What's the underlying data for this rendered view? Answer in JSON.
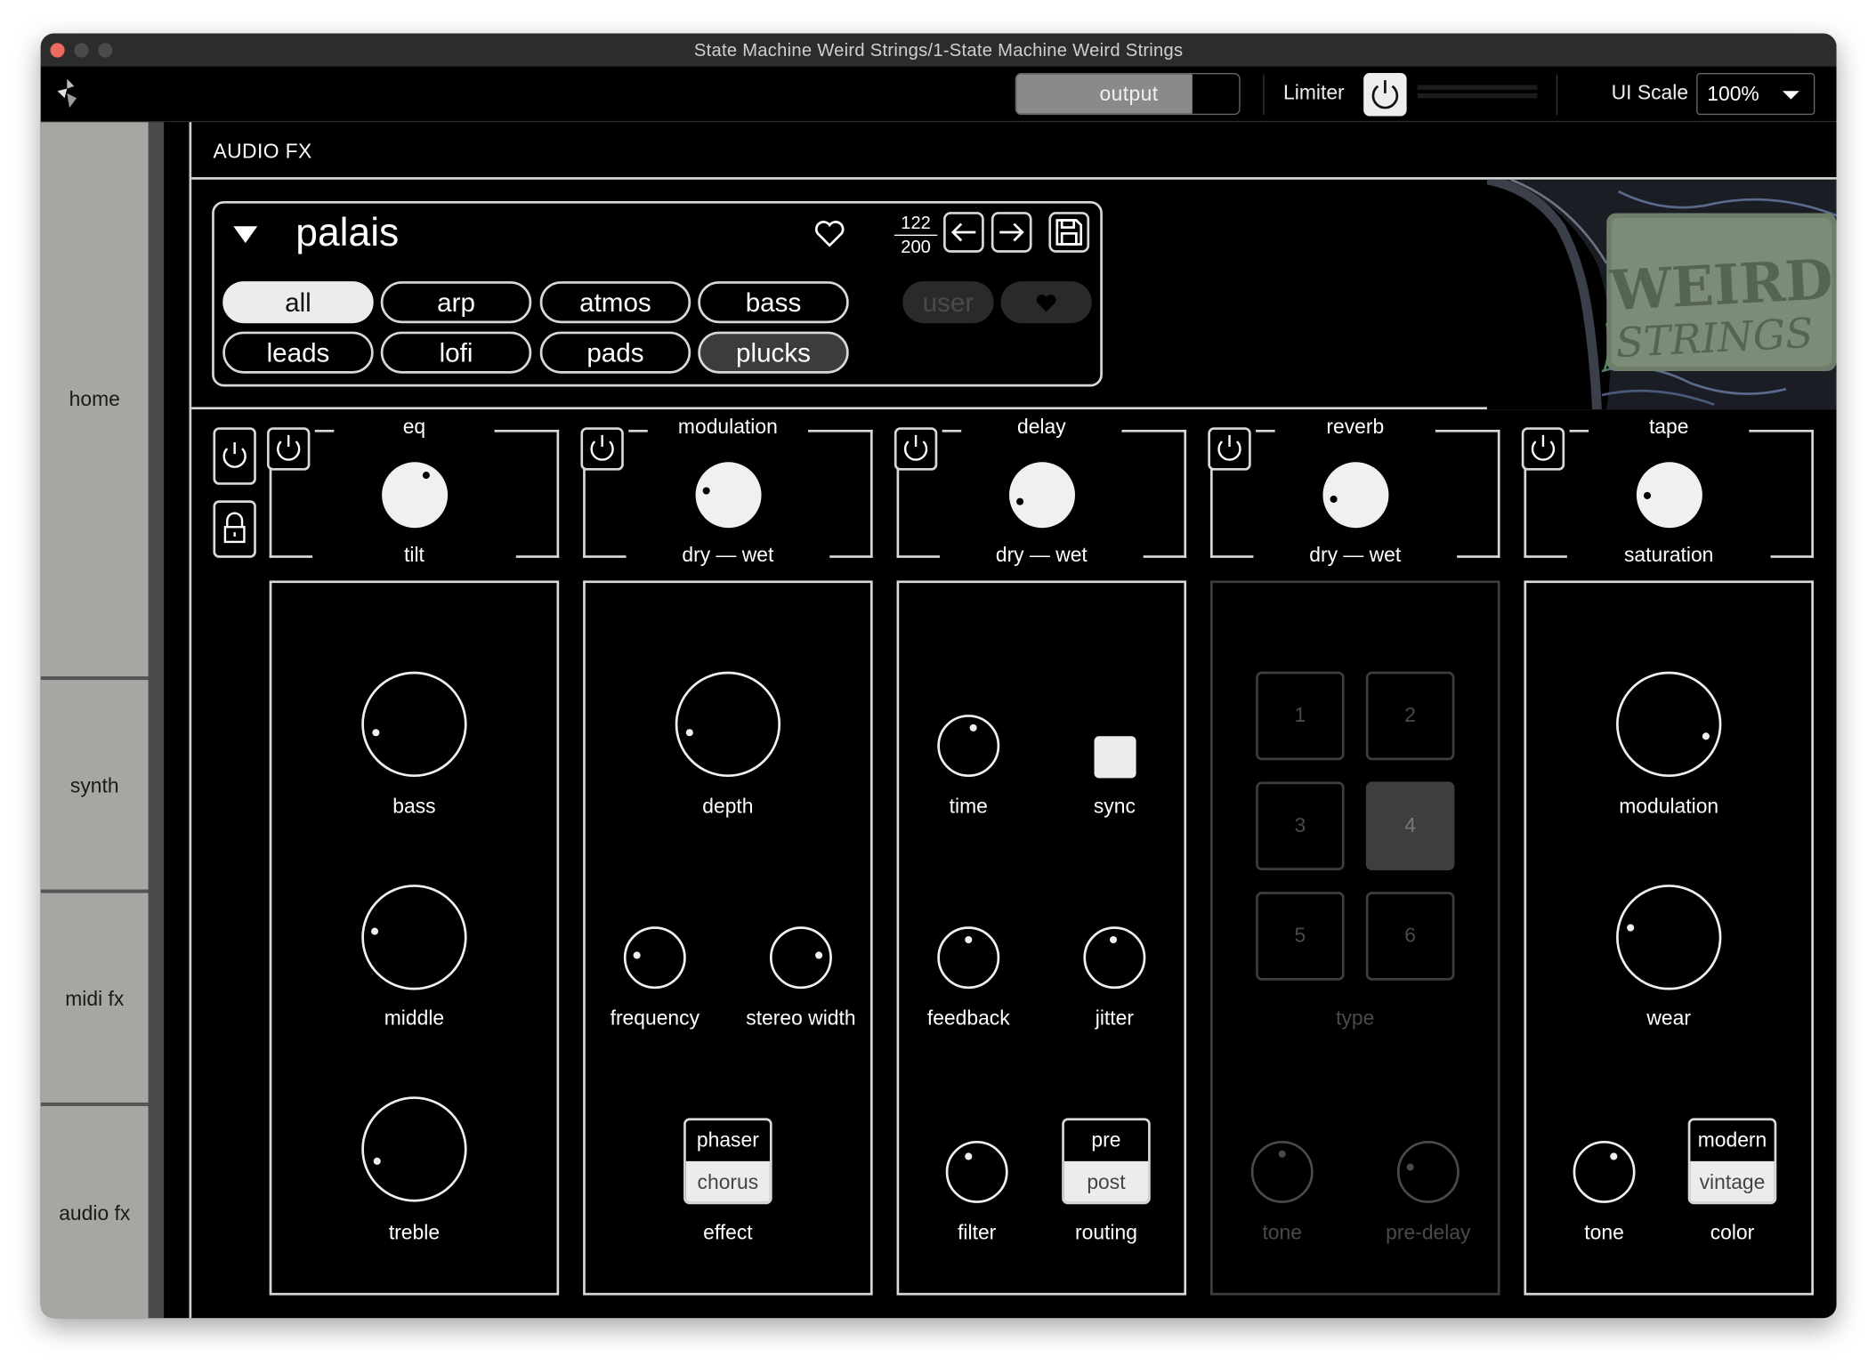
{
  "window": {
    "title": "State Machine Weird Strings/1-State Machine Weird Strings"
  },
  "topbar": {
    "output_label": "output",
    "output_level": 0.78,
    "limiter_label": "Limiter",
    "ui_scale_label": "UI Scale",
    "ui_scale_value": "100%"
  },
  "sidebar": {
    "items": [
      {
        "label": "home"
      },
      {
        "label": "synth"
      },
      {
        "label": "midi fx"
      },
      {
        "label": "audio fx"
      }
    ],
    "selected": "audio fx"
  },
  "header": {
    "title": "AUDIO FX"
  },
  "preset": {
    "name": "palais",
    "index": "122",
    "total": "200",
    "categories": [
      {
        "label": "all",
        "state": "selected"
      },
      {
        "label": "arp",
        "state": "normal"
      },
      {
        "label": "atmos",
        "state": "normal"
      },
      {
        "label": "bass",
        "state": "normal"
      },
      {
        "label": "leads",
        "state": "normal"
      },
      {
        "label": "lofi",
        "state": "normal"
      },
      {
        "label": "pads",
        "state": "normal"
      },
      {
        "label": "plucks",
        "state": "highlighted"
      }
    ],
    "user_label": "user"
  },
  "art": {
    "logo_text_line1": "WEIRD",
    "logo_text_line2": "STRINGS"
  },
  "sections": {
    "eq": {
      "title": "eq",
      "macro_label": "tilt",
      "macro_value": 0.62,
      "knobs": [
        {
          "label": "bass",
          "value": 0.12
        },
        {
          "label": "middle",
          "value": 0.2
        },
        {
          "label": "treble",
          "value": 0.1
        }
      ]
    },
    "modulation": {
      "title": "modulation",
      "macro_label": "dry — wet",
      "macro_value": 0.2,
      "depth_label": "depth",
      "depth_value": 0.12,
      "frequency_label": "frequency",
      "frequency_value": 0.2,
      "stereo_width_label": "stereo width",
      "stereo_width_value": 0.8,
      "effect_options": [
        "phaser",
        "chorus"
      ],
      "effect_selected": "chorus",
      "effect_label": "effect"
    },
    "delay": {
      "title": "delay",
      "macro_label": "dry — wet",
      "macro_value": 0.1,
      "time_label": "time",
      "time_value": 0.55,
      "sync_label": "sync",
      "feedback_label": "feedback",
      "feedback_value": 0.5,
      "jitter_label": "jitter",
      "jitter_value": 0.48,
      "filter_label": "filter",
      "filter_value": 0.4,
      "routing_options": [
        "pre",
        "post"
      ],
      "routing_selected": "post",
      "routing_label": "routing"
    },
    "reverb": {
      "title": "reverb",
      "macro_label": "dry — wet",
      "macro_value": 0.12,
      "type_options": [
        "1",
        "2",
        "3",
        "4",
        "5",
        "6"
      ],
      "type_selected": "4",
      "type_label": "type",
      "tone_label": "tone",
      "tone_value": 0.5,
      "predelay_label": "pre-delay",
      "predelay_value": 0.22
    },
    "tape": {
      "title": "tape",
      "macro_label": "saturation",
      "macro_value": 0.15,
      "modulation_label": "modulation",
      "modulation_value": 0.9,
      "wear_label": "wear",
      "wear_value": 0.22,
      "tone_label": "tone",
      "tone_value": 0.62,
      "color_options": [
        "modern",
        "vintage"
      ],
      "color_selected": "vintage",
      "color_label": "color"
    }
  },
  "colors": {
    "background": "#000000",
    "foreground": "#f0f0f0",
    "sidebar": "#a8a6a2",
    "disabled": "#4a4a4a",
    "close_button": "#ed6a5e"
  }
}
